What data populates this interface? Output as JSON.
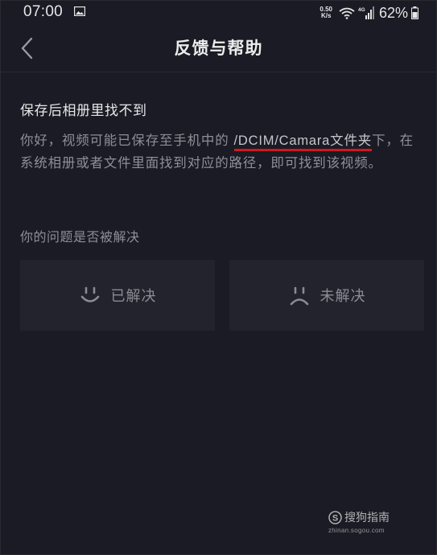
{
  "status_bar": {
    "time": "07:00",
    "net_speed_value": "0.50",
    "net_speed_unit": "K/s",
    "network_label": "4G",
    "battery_percent": "62%",
    "icons": [
      "image-icon",
      "wifi-icon",
      "signal-icon",
      "battery-icon"
    ]
  },
  "nav": {
    "title": "反馈与帮助",
    "back_icon": "chevron-left-icon"
  },
  "article": {
    "question": "保存后相册里找不到",
    "answer_prefix": "你好，视频可能已保存至手机中的 ",
    "answer_highlight": "/DCIM/Camara文件夹",
    "answer_suffix": "下，在系统相册或者文件里面找到对应的路径，即可找到该视频。",
    "highlight_underline_color": "#d0191f"
  },
  "feedback": {
    "prompt": "你的问题是否被解决",
    "resolved_label": "已解决",
    "unresolved_label": "未解决",
    "resolved_icon": "smile-icon",
    "unresolved_icon": "frown-icon"
  },
  "watermark": {
    "name": "搜狗指南",
    "url": "zhinan.sogou.com"
  },
  "colors": {
    "background": "#1a1b24",
    "button_bg": "#22232c",
    "primary_text": "#e8e8e8",
    "secondary_text": "#8d8e96"
  }
}
